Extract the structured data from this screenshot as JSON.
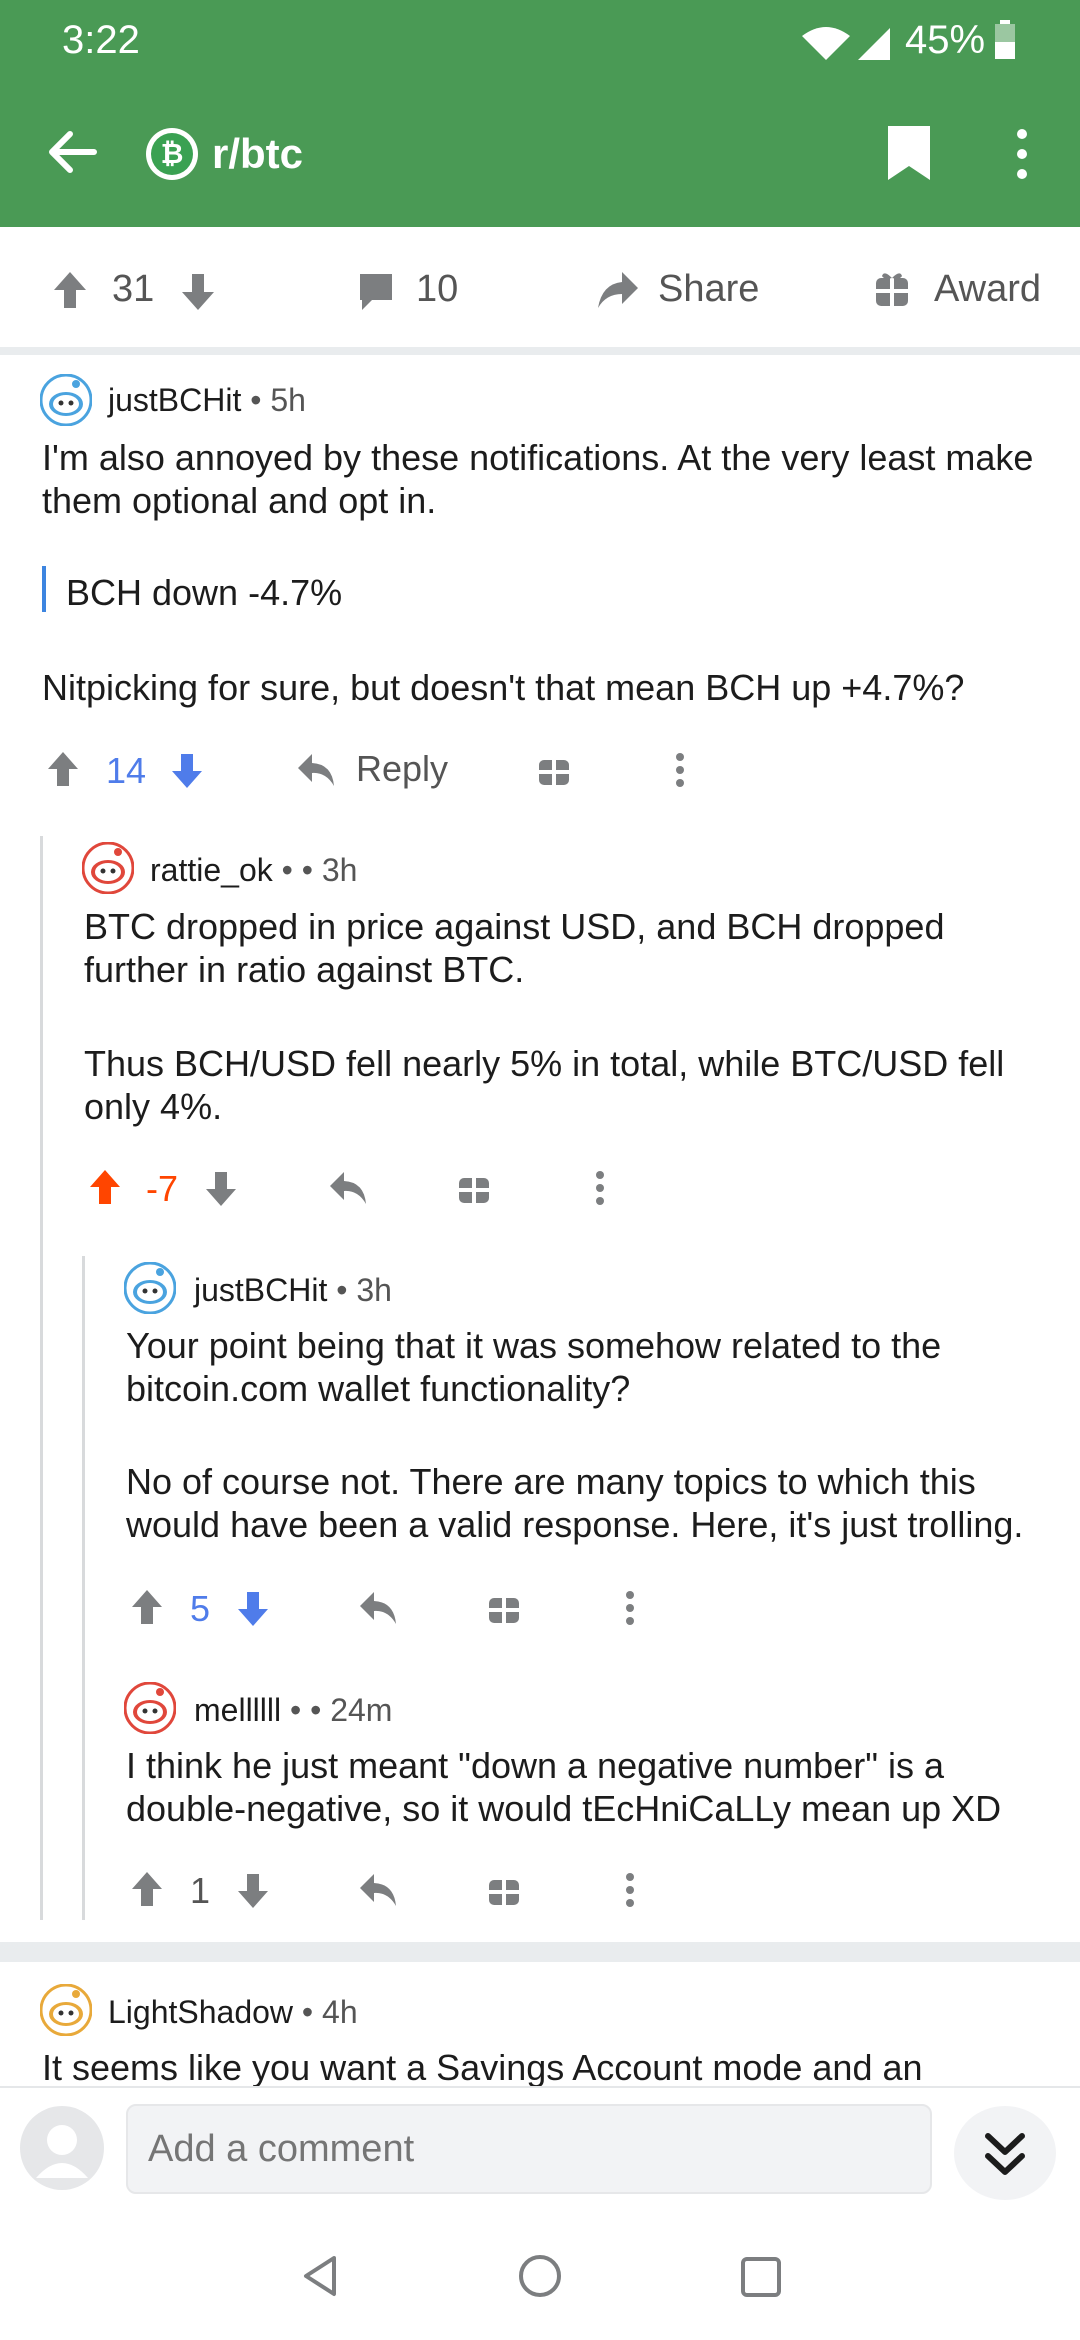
{
  "status": {
    "time": "3:22",
    "battery": "45%"
  },
  "header": {
    "subreddit": "r/btc"
  },
  "post_actions": {
    "upvotes": "31",
    "comments": "10",
    "share_label": "Share",
    "award_label": "Award"
  },
  "comments": [
    {
      "username": "justBCHit",
      "time": "5h",
      "body1": "I'm also annoyed by these notifications. At the very least make them optional and opt in.",
      "quote": "BCH down -4.7%",
      "body2": "Nitpicking for sure, but doesn't that mean BCH up +4.7%?",
      "score": "14",
      "reply_label": "Reply"
    },
    {
      "username": "rattie_ok",
      "time": "3h",
      "body1": "BTC dropped in price against USD, and BCH dropped further in ratio against BTC.",
      "body2": "Thus BCH/USD fell nearly 5% in total, while BTC/USD fell only 4%.",
      "score": "-7"
    },
    {
      "username": "justBCHit",
      "time": "3h",
      "body1": "Your point being that it was somehow related to the bitcoin.com wallet functionality?",
      "body2": "No of course not. There are many topics to which this would have been a valid response. Here, it's just trolling.",
      "score": "5"
    },
    {
      "username": "mellllll",
      "time": "24m",
      "body1": "I think he just meant \"down a negative number\" is a double-negative, so it would tEcHniCaLLy mean up XD",
      "score": "1"
    },
    {
      "username": "LightShadow",
      "time": "4h",
      "body1": "It seems like you want a Savings Account mode and an"
    }
  ],
  "comment_input": {
    "placeholder": "Add a comment"
  },
  "colors": {
    "header_green": "#4a9a55",
    "upvoted_orange": "#ff4500",
    "downvoted_blue": "#4f7cea",
    "quote_blue": "#3d85e0"
  },
  "icons": [
    "back-arrow-icon",
    "bookmark-icon",
    "overflow-menu-icon",
    "upvote-icon",
    "downvote-icon",
    "comment-icon",
    "share-icon",
    "award-icon",
    "reply-icon",
    "expand-icon",
    "nav-back-icon",
    "nav-home-icon",
    "nav-recents-icon"
  ]
}
